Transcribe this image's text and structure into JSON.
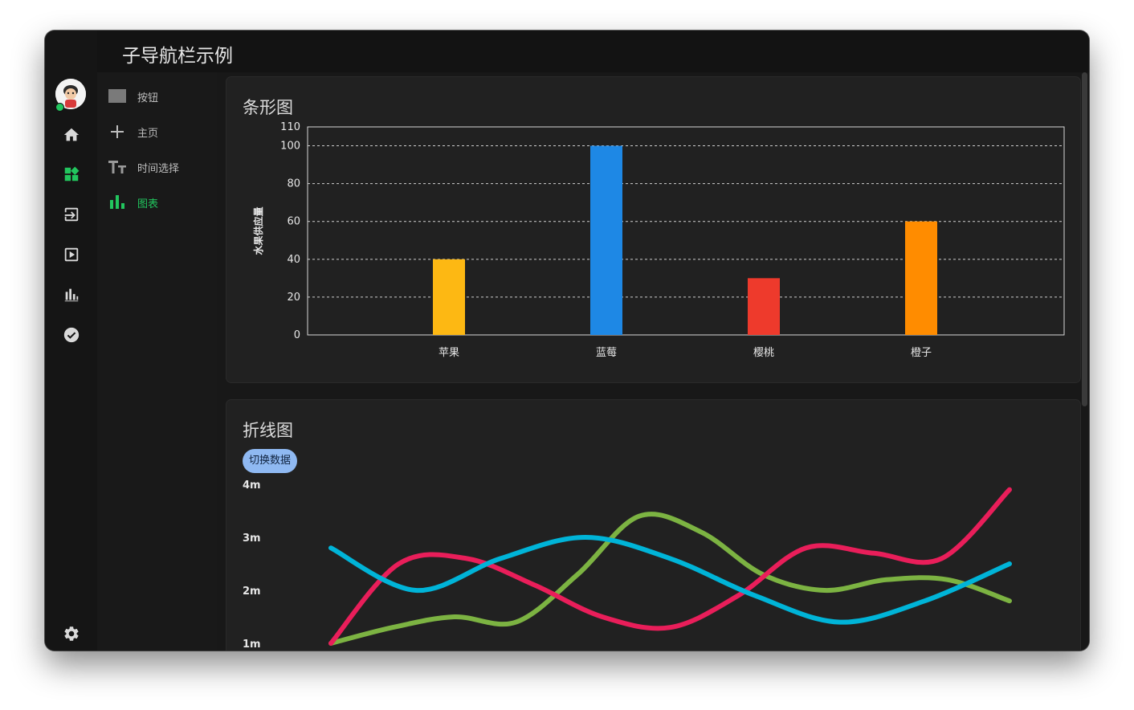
{
  "window": {
    "title": "子导航栏示例"
  },
  "rail": {
    "items": [
      {
        "name": "home",
        "icon": "home-icon"
      },
      {
        "name": "widgets",
        "icon": "widgets-icon",
        "active": true
      },
      {
        "name": "input",
        "icon": "login-icon"
      },
      {
        "name": "play",
        "icon": "play-box-icon"
      },
      {
        "name": "stats",
        "icon": "stats-icon"
      },
      {
        "name": "check",
        "icon": "check-circle-icon"
      }
    ],
    "settings_icon": "gear-icon"
  },
  "subnav": {
    "items": [
      {
        "label": "按钮",
        "icon": "rectangle-icon"
      },
      {
        "label": "主页",
        "icon": "plus-icon"
      },
      {
        "label": "时间选择",
        "icon": "text-size-icon"
      },
      {
        "label": "图表",
        "icon": "bar-chart-icon",
        "active": true
      }
    ]
  },
  "charts": {
    "bar": {
      "title": "条形图"
    },
    "line": {
      "title": "折线图",
      "toggle_label": "切换数据"
    }
  },
  "colors": {
    "accent": "#22c55e",
    "bar_apple": "#fdb813",
    "bar_blueberry": "#1e88e5",
    "bar_cherry": "#ee3a2c",
    "bar_orange": "#ff8c00",
    "line_green": "#7cb342",
    "line_pink": "#e91e5a",
    "line_cyan": "#00b4d8"
  },
  "chart_data": [
    {
      "type": "bar",
      "title": "",
      "xlabel": "",
      "ylabel": "水果供应量",
      "categories": [
        "苹果",
        "蓝莓",
        "樱桃",
        "橙子"
      ],
      "values": [
        40,
        100,
        30,
        60
      ],
      "ylim": [
        0,
        110
      ],
      "yticks": [
        0,
        20,
        40,
        60,
        80,
        100,
        110
      ],
      "grid": "horizontal dashed",
      "legend": "none"
    },
    {
      "type": "line",
      "title": "",
      "xlabel": "",
      "ylabel": "",
      "ytick_labels": [
        "1m",
        "2m",
        "3m",
        "4m"
      ],
      "ylim": [
        1,
        4
      ],
      "x": [
        1,
        2,
        3,
        4,
        5,
        6,
        7,
        8,
        9,
        10,
        11,
        12,
        13
      ],
      "series": [
        {
          "values": [
            1.0,
            1.3,
            1.5,
            1.4,
            2.3,
            3.4,
            3.1,
            2.3,
            2.0,
            2.2,
            2.2,
            1.8,
            null
          ]
        },
        {
          "values": [
            1.0,
            2.5,
            2.6,
            2.1,
            1.5,
            1.3,
            1.9,
            2.8,
            2.7,
            2.6,
            3.9,
            null,
            null
          ]
        },
        {
          "values": [
            2.8,
            2.0,
            2.6,
            3.0,
            2.6,
            1.9,
            1.4,
            1.8,
            2.5,
            null,
            null,
            null,
            null
          ]
        }
      ],
      "grid": "off",
      "legend": "none"
    }
  ]
}
